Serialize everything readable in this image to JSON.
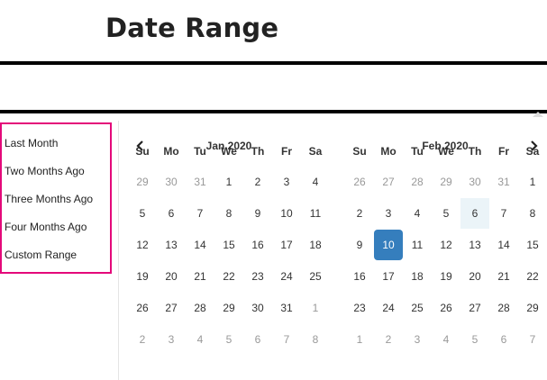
{
  "page": {
    "title": "Date Range"
  },
  "ranges": [
    "Last Month",
    "Two Months Ago",
    "Three Months Ago",
    "Four Months Ago",
    "Custom Range"
  ],
  "weekdays": [
    "Su",
    "Mo",
    "Tu",
    "We",
    "Th",
    "Fr",
    "Sa"
  ],
  "calendars": [
    {
      "month_label": "Jan 2020",
      "weeks": [
        [
          "29",
          "30",
          "31",
          "1",
          "2",
          "3",
          "4"
        ],
        [
          "5",
          "6",
          "7",
          "8",
          "9",
          "10",
          "11"
        ],
        [
          "12",
          "13",
          "14",
          "15",
          "16",
          "17",
          "18"
        ],
        [
          "19",
          "20",
          "21",
          "22",
          "23",
          "24",
          "25"
        ],
        [
          "26",
          "27",
          "28",
          "29",
          "30",
          "31",
          "1"
        ],
        [
          "2",
          "3",
          "4",
          "5",
          "6",
          "7",
          "8"
        ]
      ],
      "off": [
        [
          0,
          0
        ],
        [
          0,
          1
        ],
        [
          0,
          2
        ],
        [
          4,
          6
        ],
        [
          5,
          0
        ],
        [
          5,
          1
        ],
        [
          5,
          2
        ],
        [
          5,
          3
        ],
        [
          5,
          4
        ],
        [
          5,
          5
        ],
        [
          5,
          6
        ]
      ]
    },
    {
      "month_label": "Feb 2020",
      "weeks": [
        [
          "26",
          "27",
          "28",
          "29",
          "30",
          "31",
          "1"
        ],
        [
          "2",
          "3",
          "4",
          "5",
          "6",
          "7",
          "8"
        ],
        [
          "9",
          "10",
          "11",
          "12",
          "13",
          "14",
          "15"
        ],
        [
          "16",
          "17",
          "18",
          "19",
          "20",
          "21",
          "22"
        ],
        [
          "23",
          "24",
          "25",
          "26",
          "27",
          "28",
          "29"
        ],
        [
          "1",
          "2",
          "3",
          "4",
          "5",
          "6",
          "7"
        ]
      ],
      "off": [
        [
          0,
          0
        ],
        [
          0,
          1
        ],
        [
          0,
          2
        ],
        [
          0,
          3
        ],
        [
          0,
          4
        ],
        [
          0,
          5
        ],
        [
          5,
          0
        ],
        [
          5,
          1
        ],
        [
          5,
          2
        ],
        [
          5,
          3
        ],
        [
          5,
          4
        ],
        [
          5,
          5
        ],
        [
          5,
          6
        ]
      ],
      "today": [
        1,
        4
      ],
      "selected": [
        2,
        1
      ]
    }
  ],
  "colors": {
    "accent": "#357ebd",
    "highlight_border": "#e4097a",
    "today_bg": "#ebf4f8"
  },
  "icons": {
    "prev": "chevron-left-icon",
    "next": "chevron-right-icon"
  }
}
